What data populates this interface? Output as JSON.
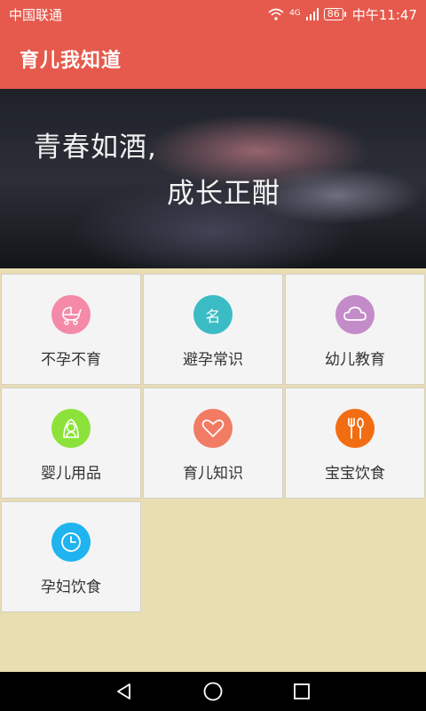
{
  "status_bar": {
    "carrier": "中国联通",
    "network": "4G",
    "battery": "86",
    "time": "中午11:47"
  },
  "app_bar": {
    "title": "育儿我知道"
  },
  "banner": {
    "line1": "青春如酒,",
    "line2": "成长正酣"
  },
  "tiles": [
    {
      "label": "不孕不育",
      "icon": "stroller-icon",
      "color": "#f48aa8"
    },
    {
      "label": "避孕常识",
      "icon": "name-tag-icon",
      "color": "#3bbcc4"
    },
    {
      "label": "幼儿教育",
      "icon": "cloud-icon",
      "color": "#c48bc9"
    },
    {
      "label": "婴儿用品",
      "icon": "baby-icon",
      "color": "#8ce23a"
    },
    {
      "label": "育儿知识",
      "icon": "heart-icon",
      "color": "#f27b63"
    },
    {
      "label": "宝宝饮食",
      "icon": "fork-spoon-icon",
      "color": "#f26d12"
    },
    {
      "label": "孕妇饮食",
      "icon": "clock-icon",
      "color": "#1fb3ef"
    }
  ],
  "colors": {
    "primary": "#e55a4c",
    "background": "#e9ddb2",
    "tile": "#f4f4f4"
  }
}
